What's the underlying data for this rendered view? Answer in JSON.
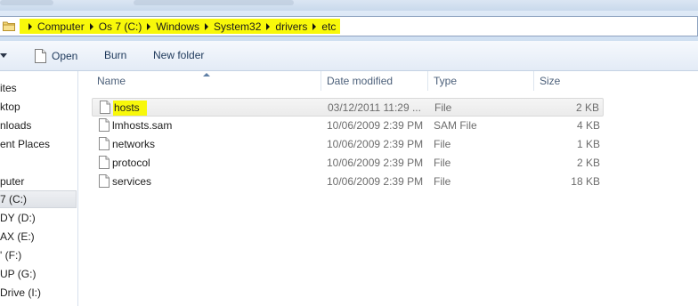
{
  "address": {
    "crumbs": [
      "Computer",
      "Os 7 (C:)",
      "Windows",
      "System32",
      "drivers",
      "etc"
    ]
  },
  "toolbar": {
    "open_label": "Open",
    "burn_label": "Burn",
    "new_folder_label": "New folder"
  },
  "nav": {
    "items": [
      "ites",
      "ktop",
      "nloads",
      "ent Places",
      "puter",
      "7 (C:)",
      "DY (D:)",
      "AX (E:)",
      "' (F:)",
      "UP (G:)",
      "Drive (I:)"
    ]
  },
  "list": {
    "columns": {
      "name": "Name",
      "date": "Date modified",
      "type": "Type",
      "size": "Size"
    },
    "rows": [
      {
        "name": "hosts",
        "date": "03/12/2011 11:29 ...",
        "type": "File",
        "size": "2 KB"
      },
      {
        "name": "lmhosts.sam",
        "date": "10/06/2009 2:39 PM",
        "type": "SAM File",
        "size": "4 KB"
      },
      {
        "name": "networks",
        "date": "10/06/2009 2:39 PM",
        "type": "File",
        "size": "1 KB"
      },
      {
        "name": "protocol",
        "date": "10/06/2009 2:39 PM",
        "type": "File",
        "size": "2 KB"
      },
      {
        "name": "services",
        "date": "10/06/2009 2:39 PM",
        "type": "File",
        "size": "18 KB"
      }
    ]
  },
  "colors": {
    "highlight": "#f8f80a",
    "command_text": "#1e395b",
    "header_text": "#4c607a",
    "detail_text": "#6d6d6d"
  }
}
